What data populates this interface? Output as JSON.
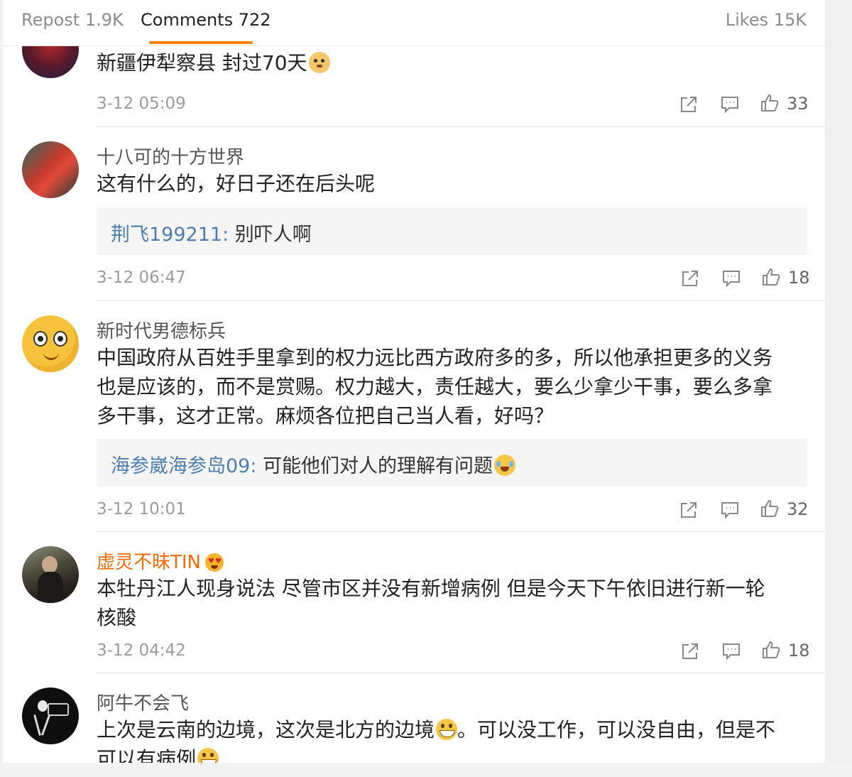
{
  "tabs": {
    "repost": "Repost 1.9K",
    "comments": "Comments 722",
    "likes": "Likes 15K"
  },
  "comments": [
    {
      "username": "",
      "text": "新疆伊犁察县 封过70天",
      "text_emoji": "doge-emoji",
      "time": "3-12 05:09",
      "likes": "33"
    },
    {
      "username": "十八可的十方世界",
      "text": "这有什么的，好日子还在后头呢",
      "reply_user": "荆飞199211",
      "reply_text": "别吓人啊",
      "time": "3-12 06:47",
      "likes": "18"
    },
    {
      "username": "新时代男德标兵",
      "text_lines": [
        "中国政府从百姓手里拿到的权力远比西方政府多的多，所以他承担更多的义务",
        "也是应该的，而不是赏赐。权力越大，责任越大，要么少拿少干事，要么多拿",
        "多干事，这才正常。麻烦各位把自己当人看，好吗？"
      ],
      "reply_user": "海参崴海参岛09",
      "reply_text": "可能他们对人的理解有问题",
      "reply_emoji": "laugh-cry-emoji",
      "time": "3-12 10:01",
      "likes": "32"
    },
    {
      "username": "虚灵不昧TIN",
      "username_emoji": "heart-eyes-emoji",
      "text_lines": [
        "本牡丹江人现身说法 尽管市区并没有新增病例 但是今天下午依旧进行新一轮",
        "核酸"
      ],
      "time": "3-12 04:42",
      "likes": "18"
    },
    {
      "username": "阿牛不会飞",
      "text_part1": "上次是云南的边境，这次是北方的边境",
      "text_part2": "。可以没工作，可以没自由，但是不",
      "text_line2": "可以有病例",
      "text_emoji": "grin-emoji"
    }
  ],
  "colors": {
    "accent": "#ff8200",
    "reply_user": "#507daf",
    "vip_name": "#f26b05"
  },
  "icons": [
    "share-icon",
    "comment-icon",
    "like-icon"
  ]
}
